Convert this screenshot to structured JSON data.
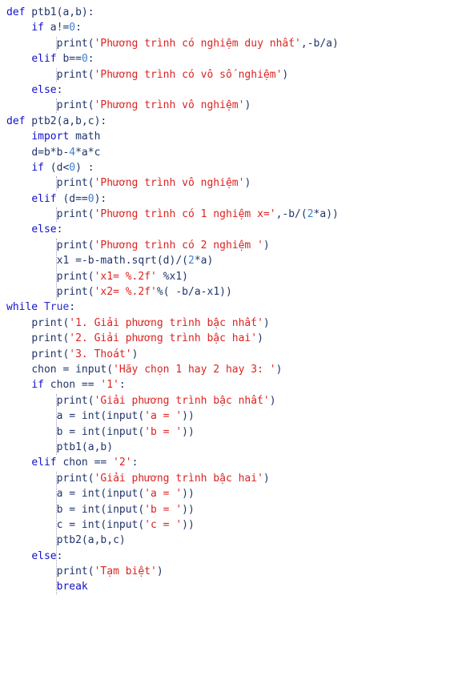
{
  "app": {
    "kind": "code-snippet",
    "language": "python",
    "background": "#ffffff",
    "colors": {
      "keyword": "#1111cc",
      "string": "#dd2222",
      "number": "#3e7fd4",
      "plain": "#21356b",
      "indent_guide": "#9aa3b8"
    }
  },
  "code": {
    "lines": [
      {
        "indent": 0,
        "tokens": [
          {
            "t": "kw",
            "v": "def"
          },
          {
            "t": "pln",
            "v": " ptb1(a,b):"
          }
        ]
      },
      {
        "indent": 1,
        "tokens": [
          {
            "t": "kw",
            "v": "if"
          },
          {
            "t": "pln",
            "v": " a!="
          },
          {
            "t": "num",
            "v": "0"
          },
          {
            "t": "pln",
            "v": ":"
          }
        ]
      },
      {
        "indent": 2,
        "tokens": [
          {
            "t": "pln",
            "v": "print("
          },
          {
            "t": "str",
            "v": "'Phương trình có nghiệm duy nhất'"
          },
          {
            "t": "pln",
            "v": ",-b/a)"
          }
        ]
      },
      {
        "indent": 1,
        "tokens": [
          {
            "t": "kw",
            "v": "elif"
          },
          {
            "t": "pln",
            "v": " b=="
          },
          {
            "t": "num",
            "v": "0"
          },
          {
            "t": "pln",
            "v": ":"
          }
        ]
      },
      {
        "indent": 2,
        "tokens": [
          {
            "t": "pln",
            "v": "print("
          },
          {
            "t": "str",
            "v": "'Phương trình có vô số nghiệm'"
          },
          {
            "t": "pln",
            "v": ")"
          }
        ]
      },
      {
        "indent": 1,
        "tokens": [
          {
            "t": "kw",
            "v": "else"
          },
          {
            "t": "pln",
            "v": ":"
          }
        ]
      },
      {
        "indent": 2,
        "tokens": [
          {
            "t": "pln",
            "v": "print("
          },
          {
            "t": "str",
            "v": "'Phương trình vô nghiệm'"
          },
          {
            "t": "pln",
            "v": ")"
          }
        ]
      },
      {
        "indent": 0,
        "tokens": [
          {
            "t": "kw",
            "v": "def"
          },
          {
            "t": "pln",
            "v": " ptb2(a,b,c):"
          }
        ]
      },
      {
        "indent": 1,
        "tokens": [
          {
            "t": "kw",
            "v": "import"
          },
          {
            "t": "pln",
            "v": " math"
          }
        ]
      },
      {
        "indent": 1,
        "tokens": [
          {
            "t": "pln",
            "v": "d=b*b-"
          },
          {
            "t": "num",
            "v": "4"
          },
          {
            "t": "pln",
            "v": "*a*c"
          }
        ]
      },
      {
        "indent": 1,
        "tokens": [
          {
            "t": "kw",
            "v": "if"
          },
          {
            "t": "pln",
            "v": " (d<"
          },
          {
            "t": "num",
            "v": "0"
          },
          {
            "t": "pln",
            "v": ") :"
          }
        ]
      },
      {
        "indent": 2,
        "tokens": [
          {
            "t": "pln",
            "v": "print("
          },
          {
            "t": "str",
            "v": "'Phương trình vô nghiệm'"
          },
          {
            "t": "pln",
            "v": ")"
          }
        ]
      },
      {
        "indent": 1,
        "tokens": [
          {
            "t": "kw",
            "v": "elif"
          },
          {
            "t": "pln",
            "v": " (d=="
          },
          {
            "t": "num",
            "v": "0"
          },
          {
            "t": "pln",
            "v": "):"
          }
        ]
      },
      {
        "indent": 2,
        "tokens": [
          {
            "t": "pln",
            "v": "print("
          },
          {
            "t": "str",
            "v": "'Phương trình có 1 nghiệm x='"
          },
          {
            "t": "pln",
            "v": ",-b/("
          },
          {
            "t": "num",
            "v": "2"
          },
          {
            "t": "pln",
            "v": "*a))"
          }
        ]
      },
      {
        "indent": 1,
        "tokens": [
          {
            "t": "kw",
            "v": "else"
          },
          {
            "t": "pln",
            "v": ":"
          }
        ]
      },
      {
        "indent": 2,
        "tokens": [
          {
            "t": "pln",
            "v": "print("
          },
          {
            "t": "str",
            "v": "'Phương trình có 2 nghiệm '"
          },
          {
            "t": "pln",
            "v": ")"
          }
        ]
      },
      {
        "indent": 2,
        "tokens": [
          {
            "t": "pln",
            "v": "x1 =-b-math.sqrt(d)/("
          },
          {
            "t": "num",
            "v": "2"
          },
          {
            "t": "pln",
            "v": "*a)"
          }
        ]
      },
      {
        "indent": 2,
        "tokens": [
          {
            "t": "pln",
            "v": "print("
          },
          {
            "t": "str",
            "v": "'x1= %.2f'"
          },
          {
            "t": "pln",
            "v": " %x1)"
          }
        ]
      },
      {
        "indent": 2,
        "tokens": [
          {
            "t": "pln",
            "v": "print("
          },
          {
            "t": "str",
            "v": "'x2= %.2f'"
          },
          {
            "t": "pln",
            "v": "%( -b/a-x1))"
          }
        ]
      },
      {
        "indent": 0,
        "tokens": [
          {
            "t": "kw",
            "v": "while"
          },
          {
            "t": "pln",
            "v": " "
          },
          {
            "t": "kw2",
            "v": "True"
          },
          {
            "t": "pln",
            "v": ":"
          }
        ]
      },
      {
        "indent": 1,
        "tokens": [
          {
            "t": "pln",
            "v": "print("
          },
          {
            "t": "str",
            "v": "'1. Giải phương trình bậc nhất'"
          },
          {
            "t": "pln",
            "v": ")"
          }
        ]
      },
      {
        "indent": 1,
        "tokens": [
          {
            "t": "pln",
            "v": "print("
          },
          {
            "t": "str",
            "v": "'2. Giải phương trình bậc hai'"
          },
          {
            "t": "pln",
            "v": ")"
          }
        ]
      },
      {
        "indent": 1,
        "tokens": [
          {
            "t": "pln",
            "v": "print("
          },
          {
            "t": "str",
            "v": "'3. Thoát'"
          },
          {
            "t": "pln",
            "v": ")"
          }
        ]
      },
      {
        "indent": 1,
        "tokens": [
          {
            "t": "pln",
            "v": "chon = input("
          },
          {
            "t": "str",
            "v": "'Hãy chọn 1 hay 2 hay 3: '"
          },
          {
            "t": "pln",
            "v": ")"
          }
        ]
      },
      {
        "indent": 1,
        "tokens": [
          {
            "t": "kw",
            "v": "if"
          },
          {
            "t": "pln",
            "v": " chon == "
          },
          {
            "t": "str",
            "v": "'1'"
          },
          {
            "t": "pln",
            "v": ":"
          }
        ]
      },
      {
        "indent": 2,
        "tokens": [
          {
            "t": "pln",
            "v": "print("
          },
          {
            "t": "str",
            "v": "'Giải phương trình bậc nhất'"
          },
          {
            "t": "pln",
            "v": ")"
          }
        ]
      },
      {
        "indent": 2,
        "tokens": [
          {
            "t": "pln",
            "v": "a = int(input("
          },
          {
            "t": "str",
            "v": "'a = '"
          },
          {
            "t": "pln",
            "v": "))"
          }
        ]
      },
      {
        "indent": 2,
        "tokens": [
          {
            "t": "pln",
            "v": "b = int(input("
          },
          {
            "t": "str",
            "v": "'b = '"
          },
          {
            "t": "pln",
            "v": "))"
          }
        ]
      },
      {
        "indent": 2,
        "tokens": [
          {
            "t": "pln",
            "v": "ptb1(a,b)"
          }
        ]
      },
      {
        "indent": 1,
        "tokens": [
          {
            "t": "kw",
            "v": "elif"
          },
          {
            "t": "pln",
            "v": " chon == "
          },
          {
            "t": "str",
            "v": "'2'"
          },
          {
            "t": "pln",
            "v": ":"
          }
        ]
      },
      {
        "indent": 2,
        "tokens": [
          {
            "t": "pln",
            "v": "print("
          },
          {
            "t": "str",
            "v": "'Giải phương trình bậc hai'"
          },
          {
            "t": "pln",
            "v": ")"
          }
        ]
      },
      {
        "indent": 2,
        "tokens": [
          {
            "t": "pln",
            "v": "a = int(input("
          },
          {
            "t": "str",
            "v": "'a = '"
          },
          {
            "t": "pln",
            "v": "))"
          }
        ]
      },
      {
        "indent": 2,
        "tokens": [
          {
            "t": "pln",
            "v": "b = int(input("
          },
          {
            "t": "str",
            "v": "'b = '"
          },
          {
            "t": "pln",
            "v": "))"
          }
        ]
      },
      {
        "indent": 2,
        "tokens": [
          {
            "t": "pln",
            "v": "c = int(input("
          },
          {
            "t": "str",
            "v": "'c = '"
          },
          {
            "t": "pln",
            "v": "))"
          }
        ]
      },
      {
        "indent": 2,
        "tokens": [
          {
            "t": "pln",
            "v": "ptb2(a,b,c)"
          }
        ]
      },
      {
        "indent": 1,
        "tokens": [
          {
            "t": "kw",
            "v": "else"
          },
          {
            "t": "pln",
            "v": ":"
          }
        ]
      },
      {
        "indent": 2,
        "tokens": [
          {
            "t": "pln",
            "v": "print("
          },
          {
            "t": "str",
            "v": "'Tạm biệt'"
          },
          {
            "t": "pln",
            "v": ")"
          }
        ]
      },
      {
        "indent": 2,
        "tokens": [
          {
            "t": "kw",
            "v": "break"
          }
        ]
      }
    ],
    "indent_guides": [
      {
        "line_start": 2,
        "line_end": 2,
        "col": 2
      },
      {
        "line_start": 4,
        "line_end": 4,
        "col": 2
      },
      {
        "line_start": 6,
        "line_end": 6,
        "col": 2
      },
      {
        "line_start": 11,
        "line_end": 11,
        "col": 2
      },
      {
        "line_start": 13,
        "line_end": 13,
        "col": 2
      },
      {
        "line_start": 15,
        "line_end": 18,
        "col": 2
      },
      {
        "line_start": 25,
        "line_end": 28,
        "col": 2
      },
      {
        "line_start": 30,
        "line_end": 37,
        "col": 2
      }
    ]
  }
}
